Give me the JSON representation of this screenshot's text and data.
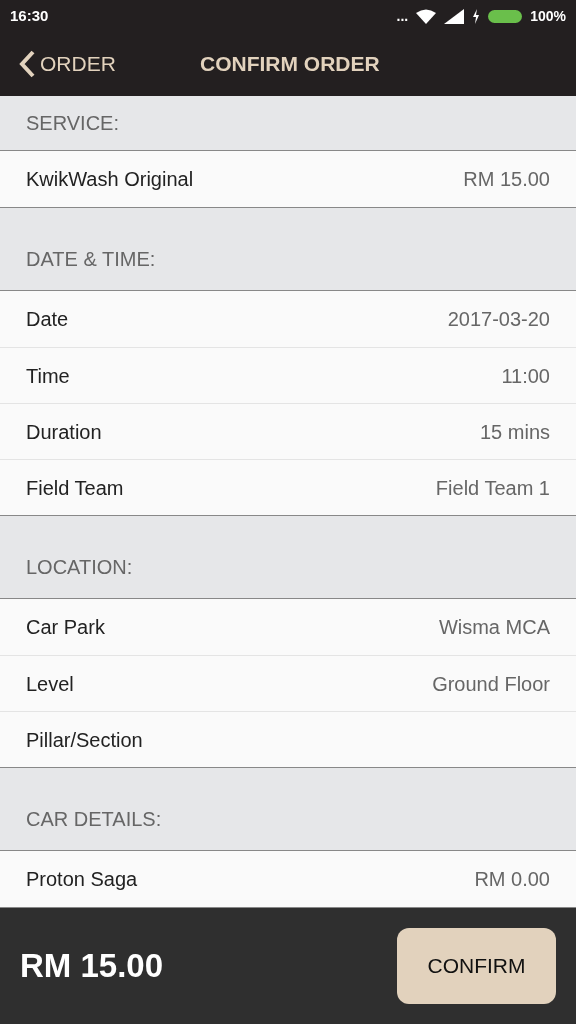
{
  "status_bar": {
    "time": "16:30",
    "more": "...",
    "battery": "100%"
  },
  "header": {
    "back": "ORDER",
    "title": "CONFIRM ORDER"
  },
  "sections": [
    {
      "title": "SERVICE:",
      "rows": [
        {
          "label": "KwikWash Original",
          "value": "RM 15.00"
        }
      ]
    },
    {
      "title": "DATE & TIME:",
      "rows": [
        {
          "label": "Date",
          "value": "2017-03-20"
        },
        {
          "label": "Time",
          "value": "11:00"
        },
        {
          "label": "Duration",
          "value": "15 mins"
        },
        {
          "label": "Field Team",
          "value": "Field Team 1"
        }
      ]
    },
    {
      "title": "LOCATION:",
      "rows": [
        {
          "label": "Car Park",
          "value": "Wisma MCA"
        },
        {
          "label": "Level",
          "value": "Ground Floor"
        },
        {
          "label": "Pillar/Section"
        }
      ]
    },
    {
      "title": "CAR DETAILS:",
      "rows": [
        {
          "label": "Proton Saga",
          "value": "RM 0.00"
        }
      ]
    }
  ],
  "footer": {
    "total": "RM 15.00",
    "button": "CONFIRM"
  }
}
